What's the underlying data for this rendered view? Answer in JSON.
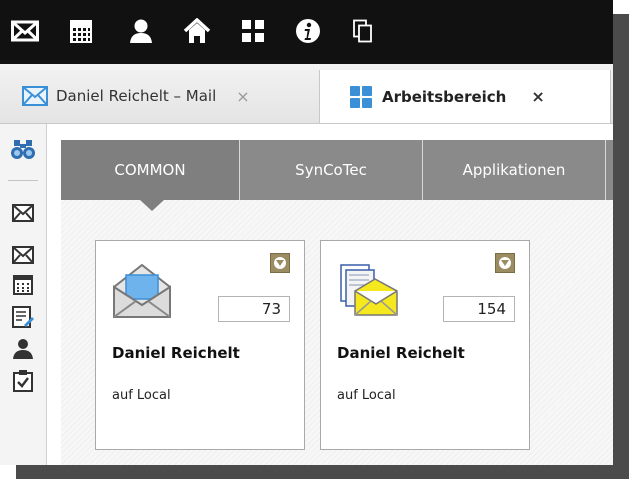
{
  "toolbar": {
    "icons": [
      "mail-icon",
      "calendar-icon",
      "contacts-icon",
      "home-icon",
      "apps-grid-icon",
      "info-icon",
      "windows-icon"
    ]
  },
  "tabs": [
    {
      "label": "Daniel Reichelt – Mail",
      "close": "×"
    },
    {
      "label": "Arbeitsbereich",
      "close": "×"
    }
  ],
  "sidebar": {
    "icons": [
      "binoculars-icon",
      "mail-icon",
      "mail-icon",
      "calendar-icon",
      "notes-icon",
      "contact-icon",
      "tasks-icon"
    ]
  },
  "subtabs": [
    {
      "label": "COMMON"
    },
    {
      "label": "SynCoTec"
    },
    {
      "label": "Applikationen"
    }
  ],
  "cards": [
    {
      "count": "73",
      "title": "Daniel Reichelt",
      "subtitle": "auf Local"
    },
    {
      "count": "154",
      "title": "Daniel Reichelt",
      "subtitle": "auf Local"
    }
  ],
  "colors": {
    "toolbar_bg": "#111111",
    "subtab_bg": "#8a8a8a",
    "mail_blue": "#3a8fd6",
    "dropdown_gold": "#9b8c62"
  }
}
